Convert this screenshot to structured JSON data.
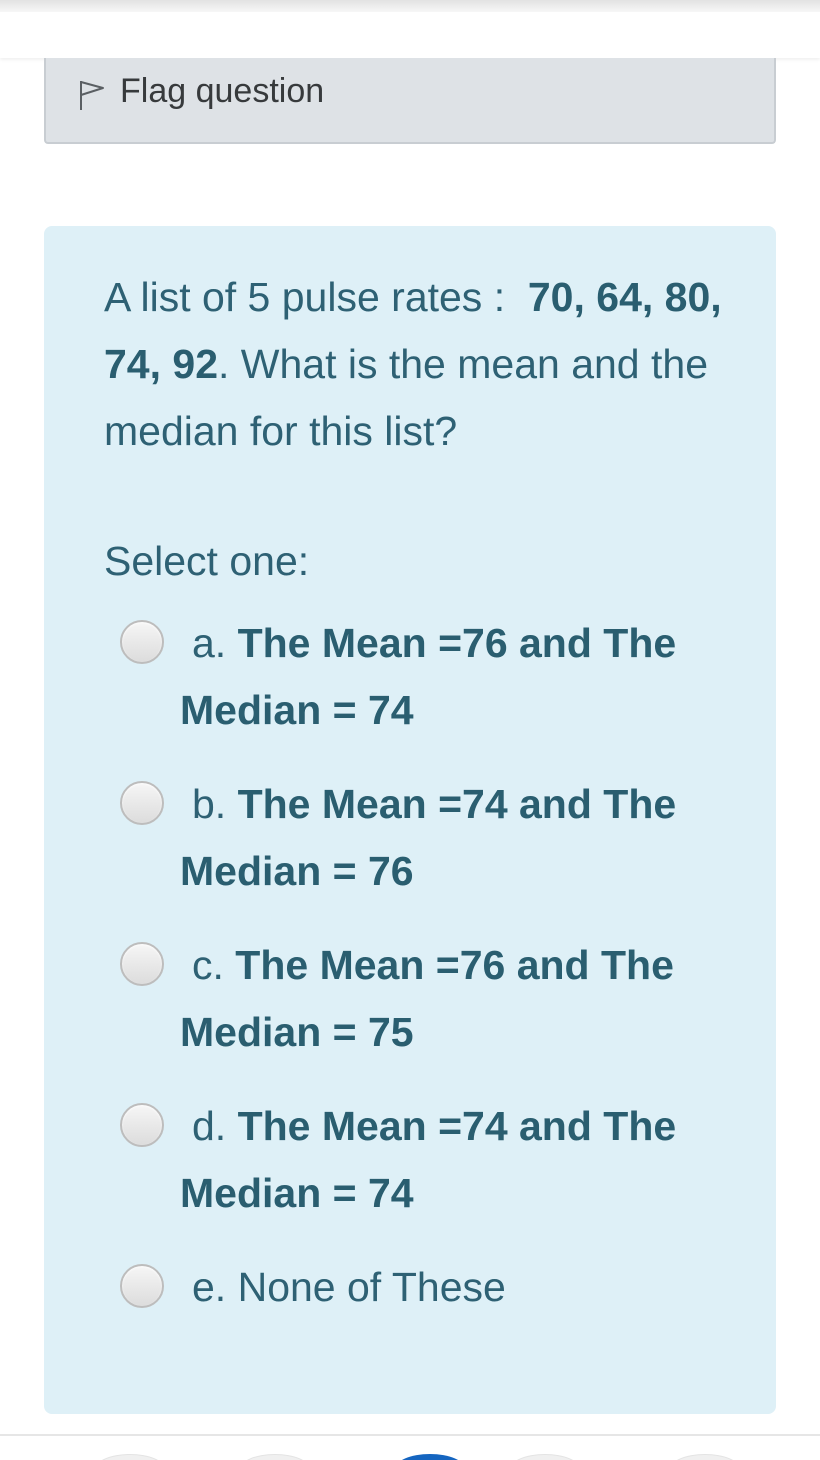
{
  "flag": {
    "label": "Flag question",
    "icon": "flag-outline-icon"
  },
  "question": {
    "text_prefix": "A list of 5 pulse rates :  ",
    "values_bold": "70, 64, 80, 74, 92",
    "text_suffix": ". What is the mean and the median for this list?",
    "prompt": "Select one:"
  },
  "options": [
    {
      "letter": "a. ",
      "line1": "The Mean =76 and The",
      "line2": "Median = 74"
    },
    {
      "letter": "b. ",
      "line1": "The Mean =74 and The",
      "line2": "Median = 76"
    },
    {
      "letter": "c. ",
      "line1": "The Mean =76 and The",
      "line2": "Median = 75"
    },
    {
      "letter": "d. ",
      "line1": "The Mean =74 and The",
      "line2": "Median = 74"
    },
    {
      "letter": "e. ",
      "line1": "None of These",
      "line2": ""
    }
  ],
  "colors": {
    "panel_bg": "#def0f7",
    "text": "#2e6174",
    "flag_bg": "#dee2e6"
  }
}
